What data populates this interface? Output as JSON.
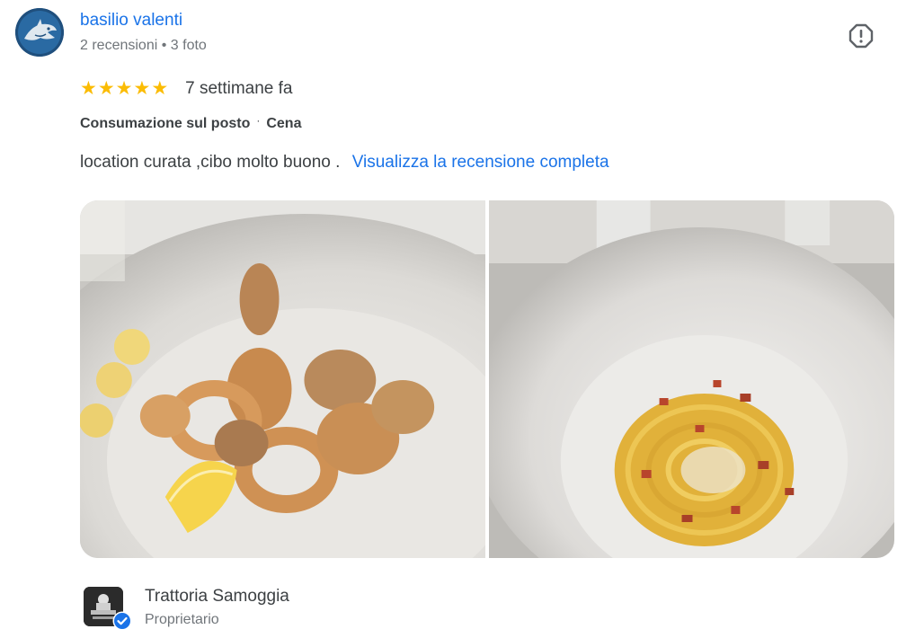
{
  "reviewer": {
    "name": "basilio valenti",
    "review_count": "2 recensioni",
    "separator": "•",
    "photo_count": "3 foto",
    "avatar_icon": "shark-avatar-icon"
  },
  "review": {
    "rating": 5,
    "stars": [
      "★",
      "★",
      "★",
      "★",
      "★"
    ],
    "date": "7 settimane fa",
    "service": "Consumazione sul posto",
    "attr_separator": "·",
    "meal": "Cena",
    "text": "location curata ,cibo molto buono .",
    "read_more": "Visualizza la recensione completa",
    "report_icon": "report-icon"
  },
  "photos": [
    {
      "subject": "fritto misto di calamari",
      "icon": "photo-fried-calamari"
    },
    {
      "subject": "spaghetti alla carbonara",
      "icon": "photo-spaghetti"
    }
  ],
  "owner": {
    "name": "Trattoria Samoggia",
    "role": "Proprietario",
    "logo_icon": "restaurant-logo-icon",
    "badge_icon": "verified-badge-icon"
  },
  "colors": {
    "link": "#1a73e8",
    "star": "#fbbc04",
    "secondary_text": "#70757a"
  }
}
